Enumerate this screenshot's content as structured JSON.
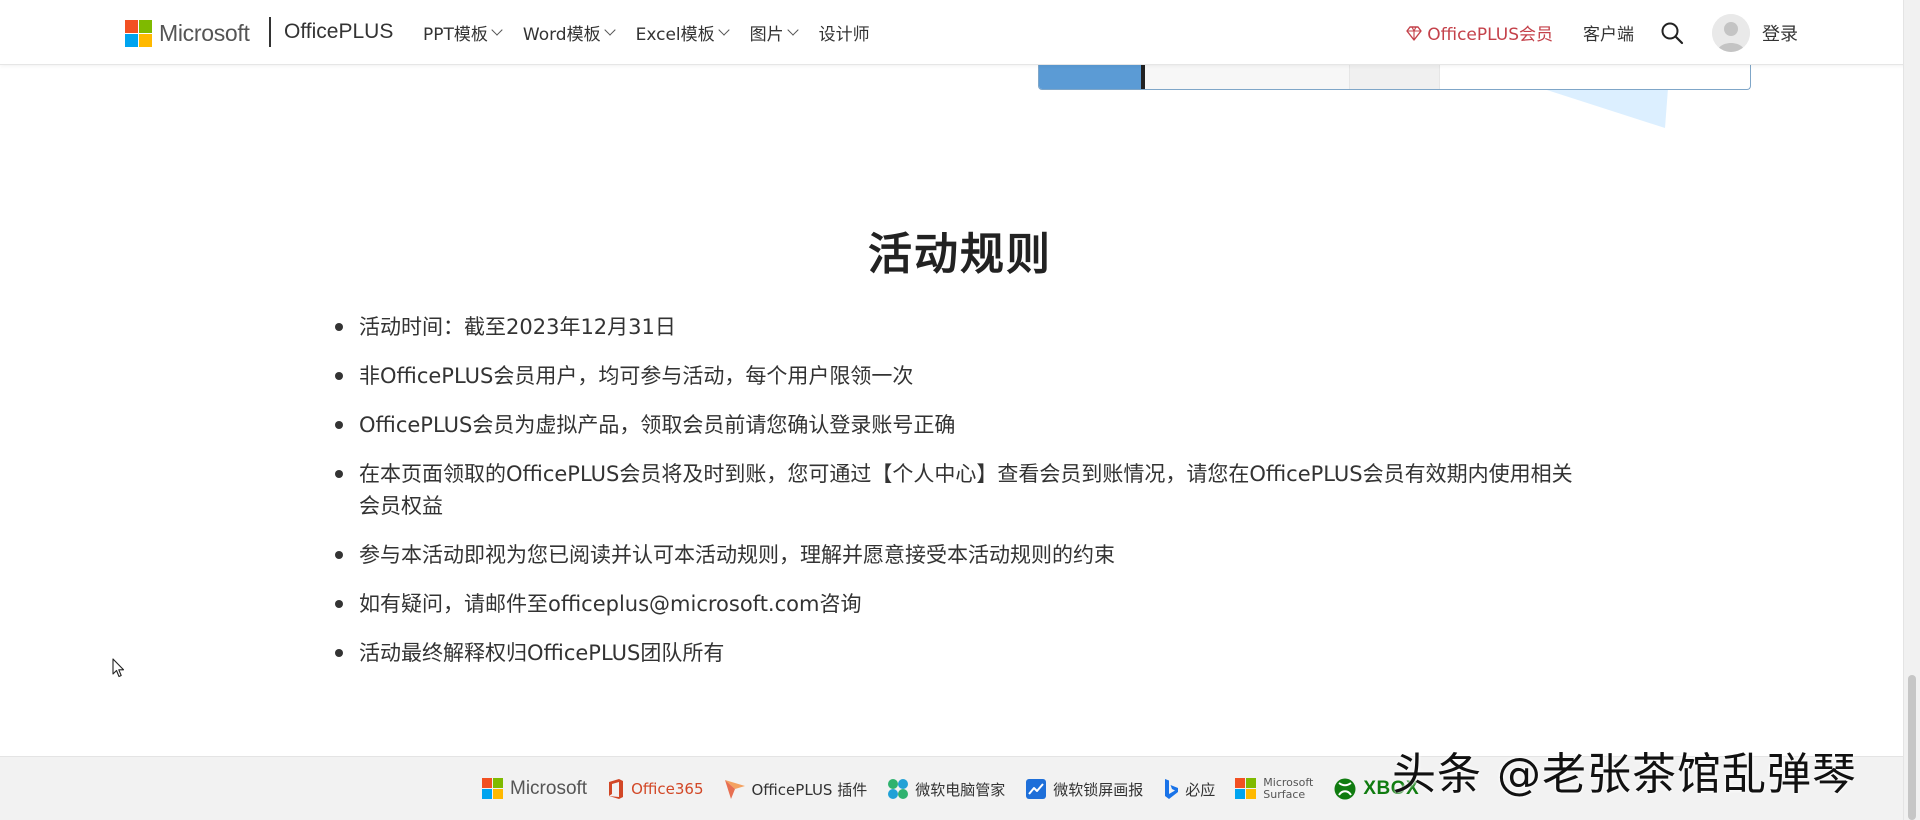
{
  "header": {
    "ms_logo_text": "Microsoft",
    "site_name": "OfficePLUS",
    "nav": [
      {
        "label": "PPT模板",
        "has_dropdown": true
      },
      {
        "label": "Word模板",
        "has_dropdown": true
      },
      {
        "label": "Excel模板",
        "has_dropdown": true
      },
      {
        "label": "图片",
        "has_dropdown": true
      },
      {
        "label": "设计师",
        "has_dropdown": false
      }
    ],
    "member_label": "OfficePLUS会员",
    "client_label": "客户端",
    "login_label": "登录"
  },
  "rules": {
    "title": "活动规则",
    "items": [
      "活动时间：截至2023年12月31日",
      "非OfficePLUS会员用户，均可参与活动，每个用户限领一次",
      "OfficePLUS会员为虚拟产品，领取会员前请您确认登录账号正确",
      "在本页面领取的OfficePLUS会员将及时到账，您可通过【个人中心】查看会员到账情况，请您在OfficePLUS会员有效期内使用相关会员权益",
      "参与本活动即视为您已阅读并认可本活动规则，理解并愿意接受本活动规则的约束",
      "如有疑问，请邮件至officeplus@microsoft.com咨询",
      "活动最终解释权归OfficePLUS团队所有"
    ]
  },
  "footer": {
    "links": [
      {
        "label": "Microsoft",
        "icon": "microsoft-logo-icon"
      },
      {
        "label": "Office365",
        "icon": "office-icon"
      },
      {
        "label": "OfficePLUS 插件",
        "icon": "officeplus-plugin-icon"
      },
      {
        "label": "微软电脑管家",
        "icon": "pc-manager-icon"
      },
      {
        "label": "微软锁屏画报",
        "icon": "lockscreen-icon"
      },
      {
        "label": "必应",
        "icon": "bing-icon"
      },
      {
        "label_line1": "Microsoft",
        "label_line2": "Surface",
        "icon": "surface-logo-icon"
      },
      {
        "label": "XBOX",
        "icon": "xbox-icon"
      }
    ]
  },
  "watermark": "头条 @老张茶馆乱弹琴",
  "colors": {
    "member_accent": "#c4414a",
    "office_orange": "#d24726",
    "ms_red": "#f25022",
    "ms_green": "#7fba00",
    "ms_blue": "#00a4ef",
    "ms_yellow": "#ffb900",
    "xbox_green": "#107c10"
  }
}
